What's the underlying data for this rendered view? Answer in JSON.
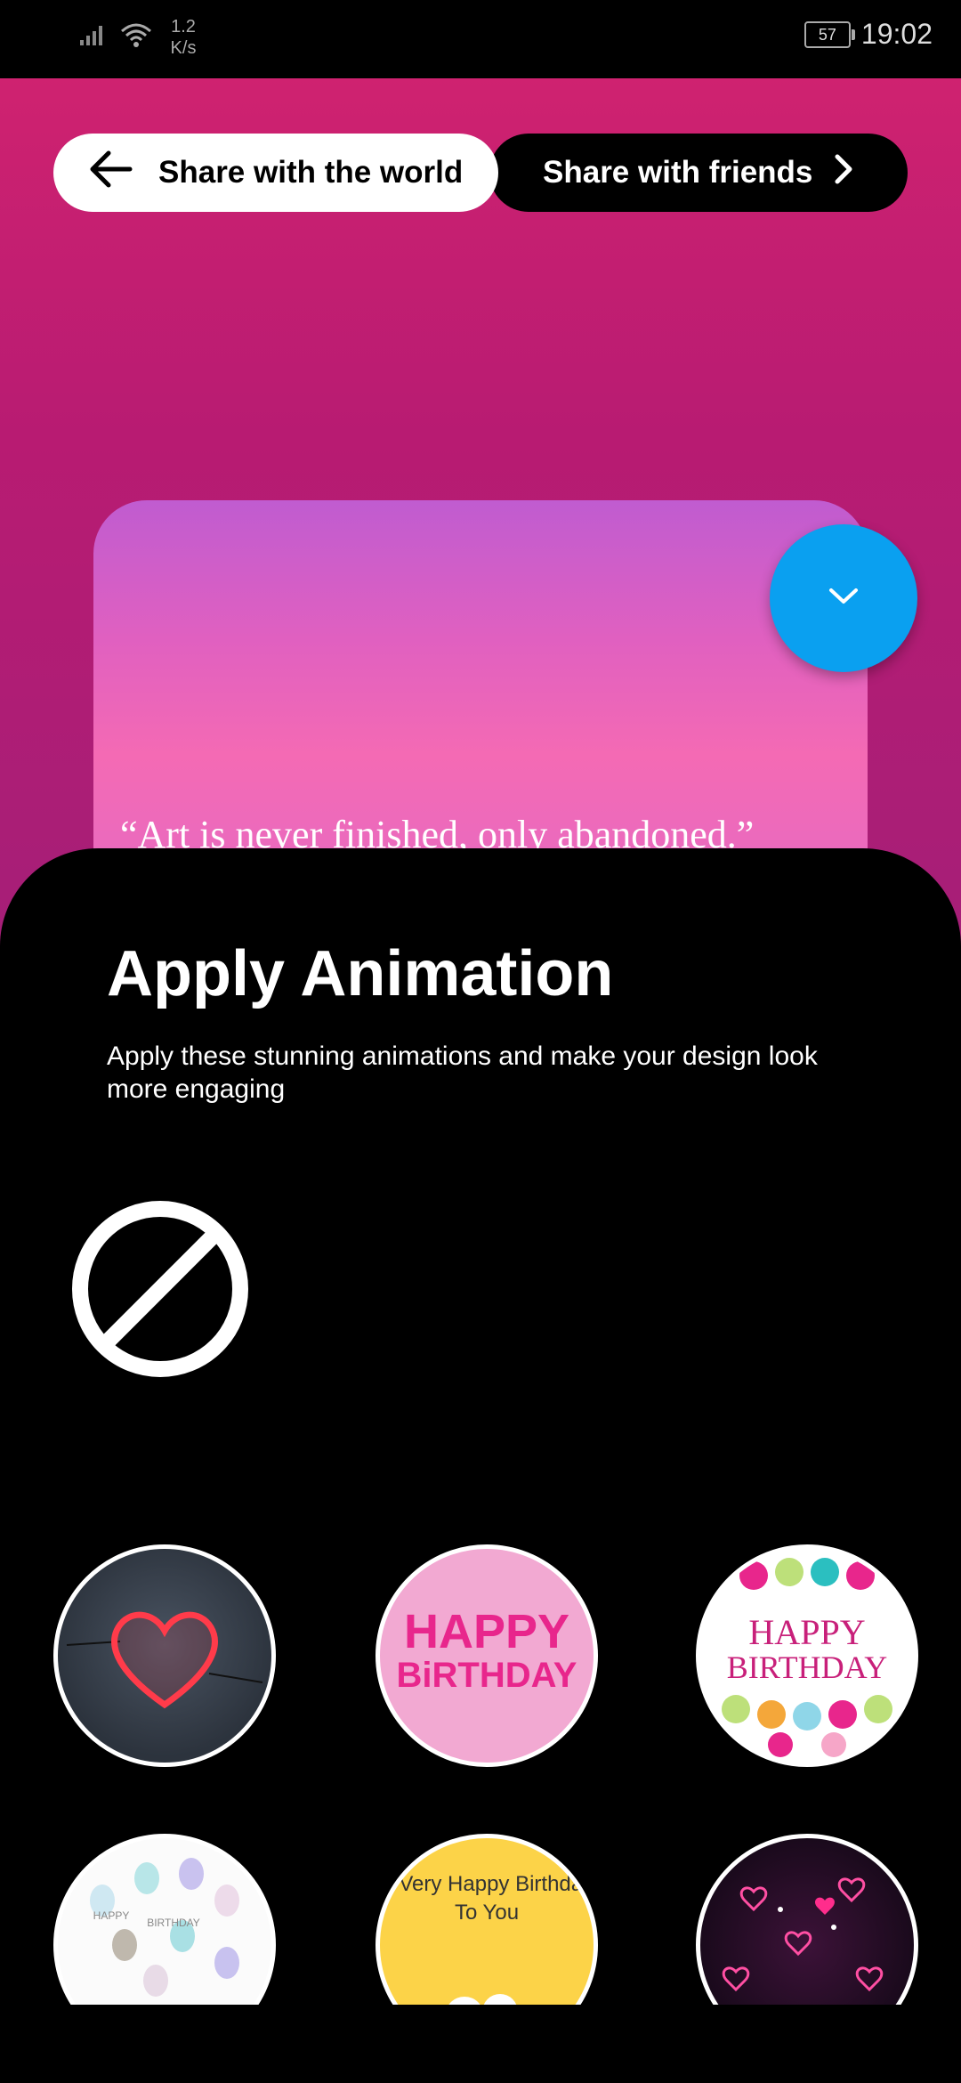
{
  "status_bar": {
    "net_speed_value": "1.2",
    "net_speed_unit": "K/s",
    "battery": "57",
    "time": "19:02"
  },
  "header": {
    "share_world_label": "Share with the world",
    "share_friends_label": "Share with friends"
  },
  "preview": {
    "quote": "“Art is never finished, only abandoned.”"
  },
  "sheet": {
    "title": "Apply Animation",
    "description": "Apply these stunning animations and make your design look more engaging"
  },
  "animations": {
    "bday1_line1": "HAPPY",
    "bday1_line2": "BiRTHDAY",
    "bday2_line1": "HAPPY",
    "bday2_line2": "BIRTHDAY",
    "balloons_text1": "HAPPY",
    "balloons_text2": "BIRTHDAY",
    "yellow_line1": "A Very Happy Birthday",
    "yellow_line2": "To You"
  },
  "colors": {
    "accent_fab": "#0aa0f0",
    "bg_gradient_top": "#cf2270",
    "bg_gradient_bottom": "#a51f78"
  }
}
